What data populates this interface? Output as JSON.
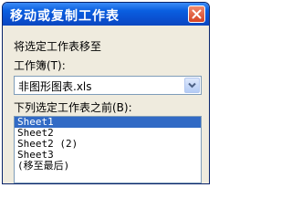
{
  "dialog": {
    "title": "移动或复制工作表",
    "section_label": "将选定工作表移至",
    "workbook_label": "工作簿(T):",
    "workbook_value": "非图形图表.xls",
    "before_sheet_label": "下列选定工作表之前(B):",
    "sheets": [
      "Sheet1",
      "Sheet2",
      "Sheet2 (2)",
      "Sheet3",
      "(移至最后)"
    ],
    "selected_sheet_index": 0
  },
  "colors": {
    "title_bar": "#0a50d0",
    "dialog_bg": "#efebde",
    "selection": "#316ac5",
    "close_button": "#d54324"
  },
  "icons": {
    "close": "close-icon",
    "dropdown": "chevron-down-icon"
  }
}
